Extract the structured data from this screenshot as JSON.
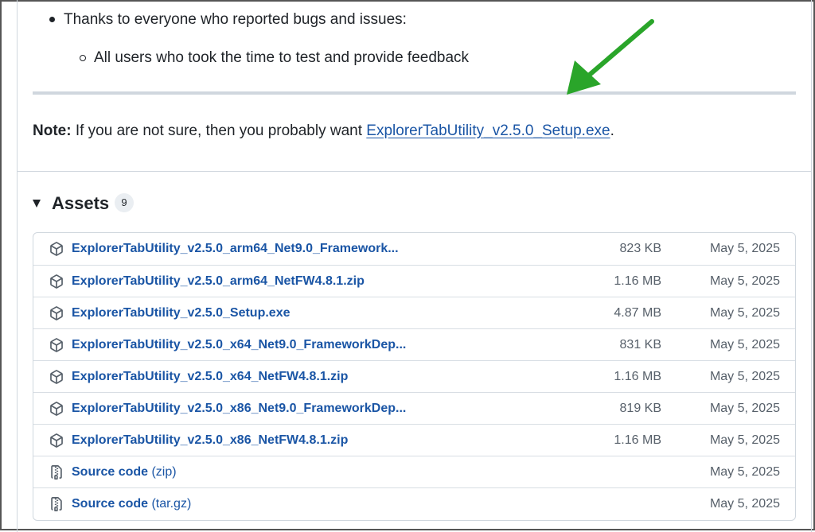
{
  "release_notes": {
    "bullet_thanks": "Thanks to everyone who reported bugs and issues:",
    "sub_bullet": "All users who took the time to test and provide feedback"
  },
  "note": {
    "label": "Note:",
    "text": " If you are not sure, then you probably want ",
    "link": "ExplorerTabUtility_v2.5.0_Setup.exe",
    "trailing": "."
  },
  "annotation": {
    "arrow_color": "#2aa52a"
  },
  "assets": {
    "title": "Assets",
    "count": "9",
    "items": [
      {
        "name": "ExplorerTabUtility_v2.5.0_arm64_Net9.0_Framework...",
        "suffix": "",
        "size": "823 KB",
        "date": "May 5, 2025",
        "icon": "package-icon"
      },
      {
        "name": "ExplorerTabUtility_v2.5.0_arm64_NetFW4.8.1.zip",
        "suffix": "",
        "size": "1.16 MB",
        "date": "May 5, 2025",
        "icon": "package-icon"
      },
      {
        "name": "ExplorerTabUtility_v2.5.0_Setup.exe",
        "suffix": "",
        "size": "4.87 MB",
        "date": "May 5, 2025",
        "icon": "package-icon"
      },
      {
        "name": "ExplorerTabUtility_v2.5.0_x64_Net9.0_FrameworkDep...",
        "suffix": "",
        "size": "831 KB",
        "date": "May 5, 2025",
        "icon": "package-icon"
      },
      {
        "name": "ExplorerTabUtility_v2.5.0_x64_NetFW4.8.1.zip",
        "suffix": "",
        "size": "1.16 MB",
        "date": "May 5, 2025",
        "icon": "package-icon"
      },
      {
        "name": "ExplorerTabUtility_v2.5.0_x86_Net9.0_FrameworkDep...",
        "suffix": "",
        "size": "819 KB",
        "date": "May 5, 2025",
        "icon": "package-icon"
      },
      {
        "name": "ExplorerTabUtility_v2.5.0_x86_NetFW4.8.1.zip",
        "suffix": "",
        "size": "1.16 MB",
        "date": "May 5, 2025",
        "icon": "package-icon"
      },
      {
        "name": "Source code",
        "suffix": " (zip)",
        "size": "",
        "date": "May 5, 2025",
        "icon": "file-zip-icon"
      },
      {
        "name": "Source code",
        "suffix": " (tar.gz)",
        "size": "",
        "date": "May 5, 2025",
        "icon": "file-zip-icon"
      }
    ]
  }
}
